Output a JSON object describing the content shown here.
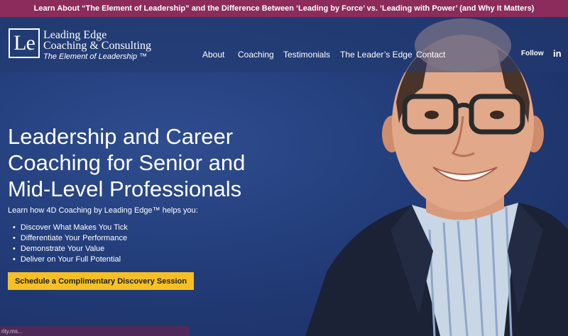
{
  "announcement": {
    "text": "Learn About “The Element of Leadership” and the Difference Between ‘Leading by Force’ vs. ‘Leading with Power’ (and Why It Matters)"
  },
  "logo": {
    "mark": "Le",
    "line1": "Leading Edge",
    "line2": "Coaching & Consulting",
    "tagline": "The Element of Leadership ™"
  },
  "nav": {
    "items": [
      {
        "label": "About"
      },
      {
        "label": "Coaching"
      },
      {
        "label": "Testimonials"
      },
      {
        "label": "The Leader’s Edge"
      },
      {
        "label": "Contact"
      }
    ],
    "follow_label": "Follow",
    "linkedin_label": "in"
  },
  "hero": {
    "headline_line1": "Leadership and Career",
    "headline_line2": "Coaching for Senior and",
    "headline_line3": "Mid-Level Professionals",
    "subhead": "Learn how 4D Coaching by Leading Edge™ helps you:",
    "bullets": [
      "Discover What Makes You Tick",
      "Differentiate Your Performance",
      "Demonstrate Your Value",
      "Deliver on Your Full Potential"
    ],
    "cta_label": "Schedule a Complimentary Discovery Session"
  },
  "status": {
    "text": "rity.ms..."
  },
  "colors": {
    "announcement_bg": "#8b2c5c",
    "hero_bg": "#233d7a",
    "cta_bg": "#f6c025"
  }
}
